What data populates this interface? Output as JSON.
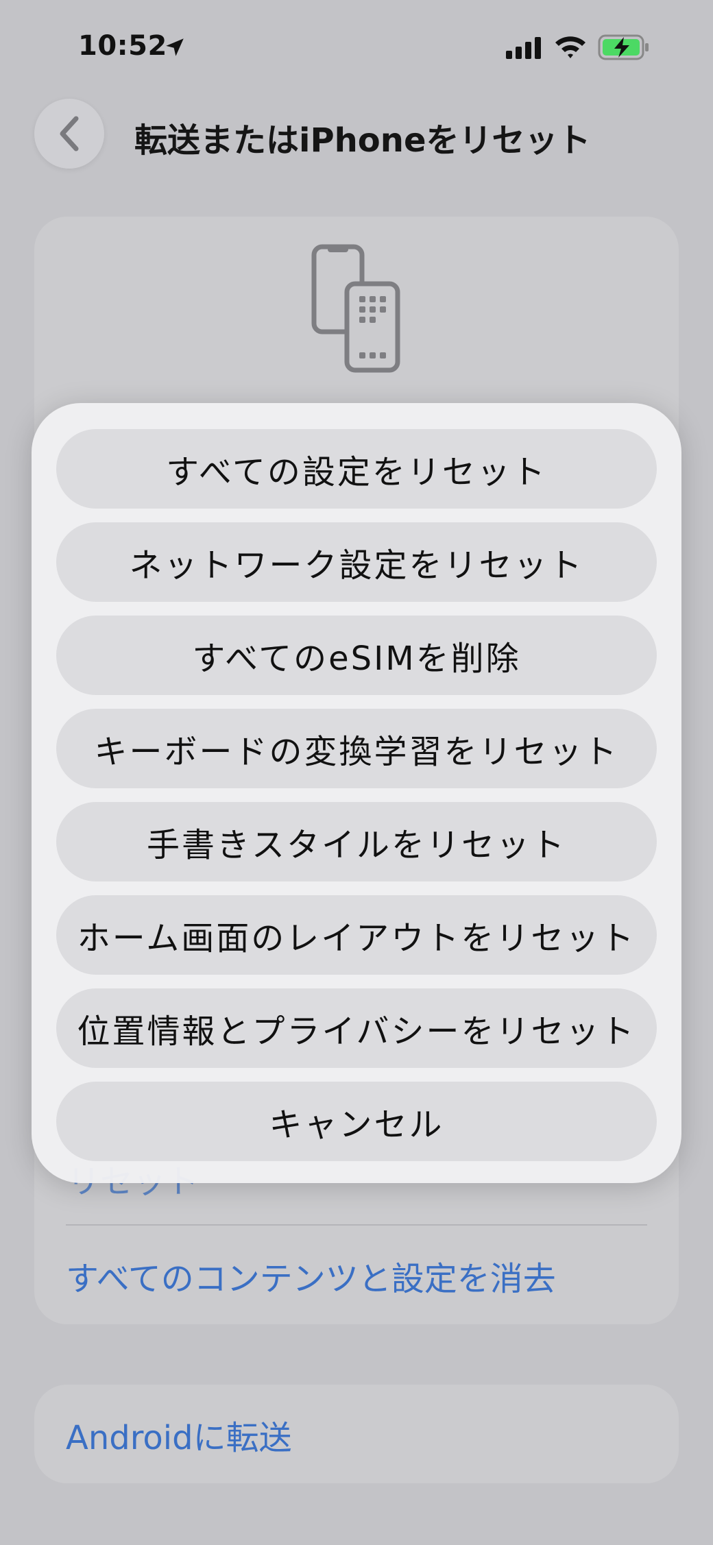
{
  "status_bar": {
    "time": "10:52",
    "icons": [
      "location-arrow-icon",
      "cellular-signal-icon",
      "wifi-icon",
      "battery-charging-icon"
    ],
    "battery_color": "#4cd964"
  },
  "nav": {
    "back_icon": "chevron-left-icon",
    "title": "転送またはiPhoneをリセット"
  },
  "main_card": {
    "icon": "two-phones-transfer-icon",
    "blurred_text": "",
    "partial_row": "リセット",
    "erase_row": "すべてのコンテンツと設定を消去"
  },
  "android_card": {
    "label": "Androidに転送"
  },
  "action_sheet": {
    "buttons": [
      "すべての設定をリセット",
      "ネットワーク設定をリセット",
      "すべてのeSIMを削除",
      "キーボードの変換学習をリセット",
      "手書きスタイルをリセット",
      "ホーム画面のレイアウトをリセット",
      "位置情報とプライバシーをリセット",
      "キャンセル"
    ]
  },
  "colors": {
    "link_blue": "#3a6fc4",
    "background": "#c3c3c7",
    "sheet_bg": "#f0f0f3",
    "button_bg": "#dcdcdf"
  }
}
